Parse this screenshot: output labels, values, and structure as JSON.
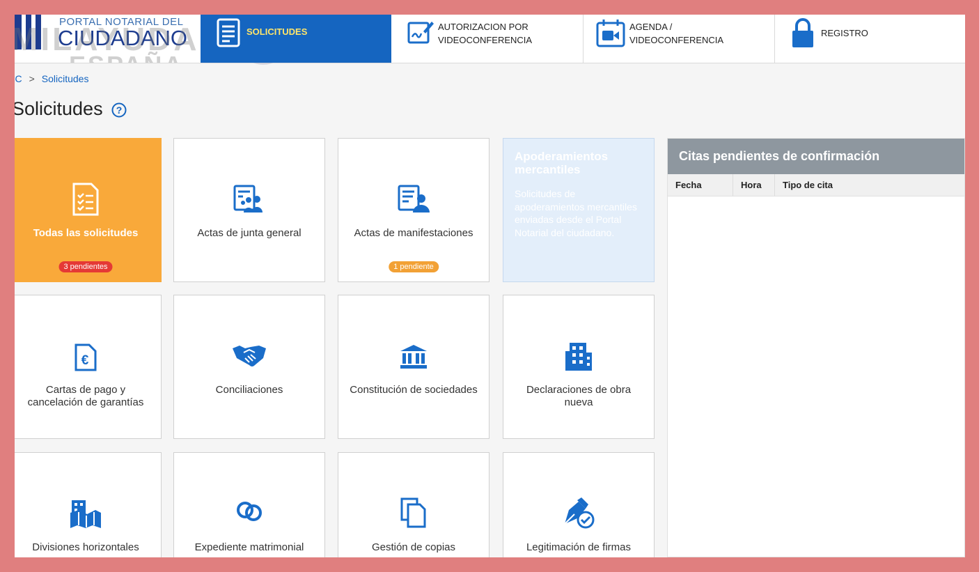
{
  "header": {
    "logo": {
      "line1": "PORTAL NOTARIAL DEL",
      "line2": "CIUDADANO"
    },
    "watermark": {
      "line1": "MILAYUDAS",
      "line2": "ESPAÑA"
    },
    "nav": [
      {
        "label": "SOLICITUDES",
        "icon": "document-list-icon",
        "active": true
      },
      {
        "label_line1": "AUTORIZACION POR",
        "label_line2": "VIDEOCONFERENCIA",
        "icon": "signature-edit-icon"
      },
      {
        "label_line1": "AGENDA /",
        "label_line2": "VIDEOCONFERENCIA",
        "icon": "calendar-video-icon"
      },
      {
        "label": "REGISTRO",
        "icon": "lock-icon"
      }
    ]
  },
  "breadcrumb": {
    "root": "PNC",
    "current": "Solicitudes"
  },
  "page": {
    "title": "Solicitudes",
    "help_icon": "help-icon"
  },
  "cards": {
    "todas": {
      "label": "Todas las solicitudes",
      "badge": "3 pendientes",
      "icon": "checklist-icon"
    },
    "actas_junta": {
      "label": "Actas de junta general",
      "icon": "meeting-document-icon"
    },
    "actas_manif": {
      "label": "Actas de manifestaciones",
      "badge": "1 pendiente",
      "icon": "person-document-icon"
    },
    "apoder": {
      "title": "Apoderamientos mercantiles",
      "description": "Solicitudes de apoderamientos mercantiles enviadas desde el Portal Notarial del ciudadano."
    },
    "cartas": {
      "label_line1": "Cartas de pago y",
      "label_line2": "cancelación de garantías",
      "icon": "euro-document-icon"
    },
    "conciliaciones": {
      "label": "Conciliaciones",
      "icon": "handshake-icon"
    },
    "constitucion": {
      "label": "Constitución de sociedades",
      "icon": "institution-icon"
    },
    "declaraciones": {
      "label_line1": "Declaraciones de obra",
      "label_line2": "nueva",
      "icon": "building-icon"
    },
    "divisiones": {
      "label": "Divisiones horizontales",
      "icon": "city-map-icon"
    },
    "expediente": {
      "label": "Expediente matrimonial",
      "icon": "rings-icon"
    },
    "copias": {
      "label": "Gestión de copias",
      "icon": "copies-icon"
    },
    "legitimacion": {
      "label": "Legitimación de firmas",
      "icon": "pen-check-icon"
    }
  },
  "citas": {
    "title": "Citas pendientes de confirmación",
    "columns": [
      "Fecha",
      "Hora",
      "Tipo de cita"
    ]
  },
  "colors": {
    "primary": "#1565c0",
    "icon_blue": "#1a6dc9",
    "accent_orange": "#f9a93a",
    "badge_red": "#e53935",
    "badge_orange": "#f2a135",
    "panel_grey": "#8e979f",
    "page_bg": "#f5f5f5"
  }
}
